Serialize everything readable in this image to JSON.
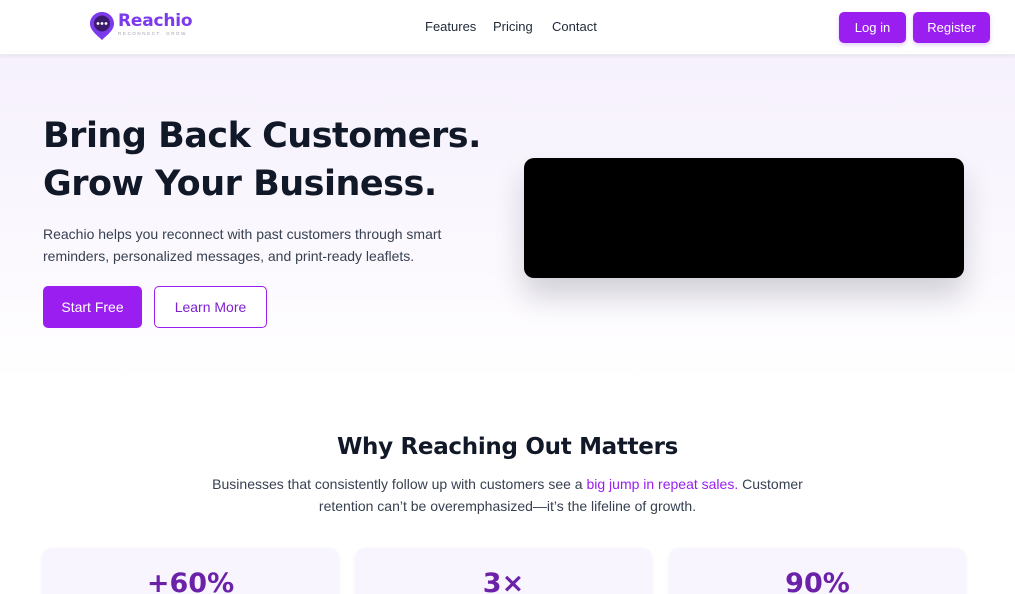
{
  "brand": {
    "name": "Reachio",
    "tagline": "RECONNECT. GROW",
    "accent": "#9b1ef0"
  },
  "nav": {
    "items": [
      "Features",
      "Pricing",
      "Contact"
    ]
  },
  "auth": {
    "login_label": "Log in",
    "register_label": "Register"
  },
  "hero": {
    "title_line1": "Bring Back Customers.",
    "title_line2": "Grow Your Business.",
    "description": "Reachio helps you reconnect with past customers through smart reminders, personalized messages, and print-ready leaflets.",
    "primary_cta": "Start Free",
    "secondary_cta": "Learn More"
  },
  "why": {
    "title": "Why Reaching Out Matters",
    "desc_before": "Businesses that consistently follow up with customers see a ",
    "desc_highlight": "big jump in repeat sales.",
    "desc_after": " Customer retention can’t be overemphasized—it’s the lifeline of growth."
  },
  "stats": [
    {
      "value": "+60%"
    },
    {
      "value": "3×"
    },
    {
      "value": "90%"
    }
  ]
}
